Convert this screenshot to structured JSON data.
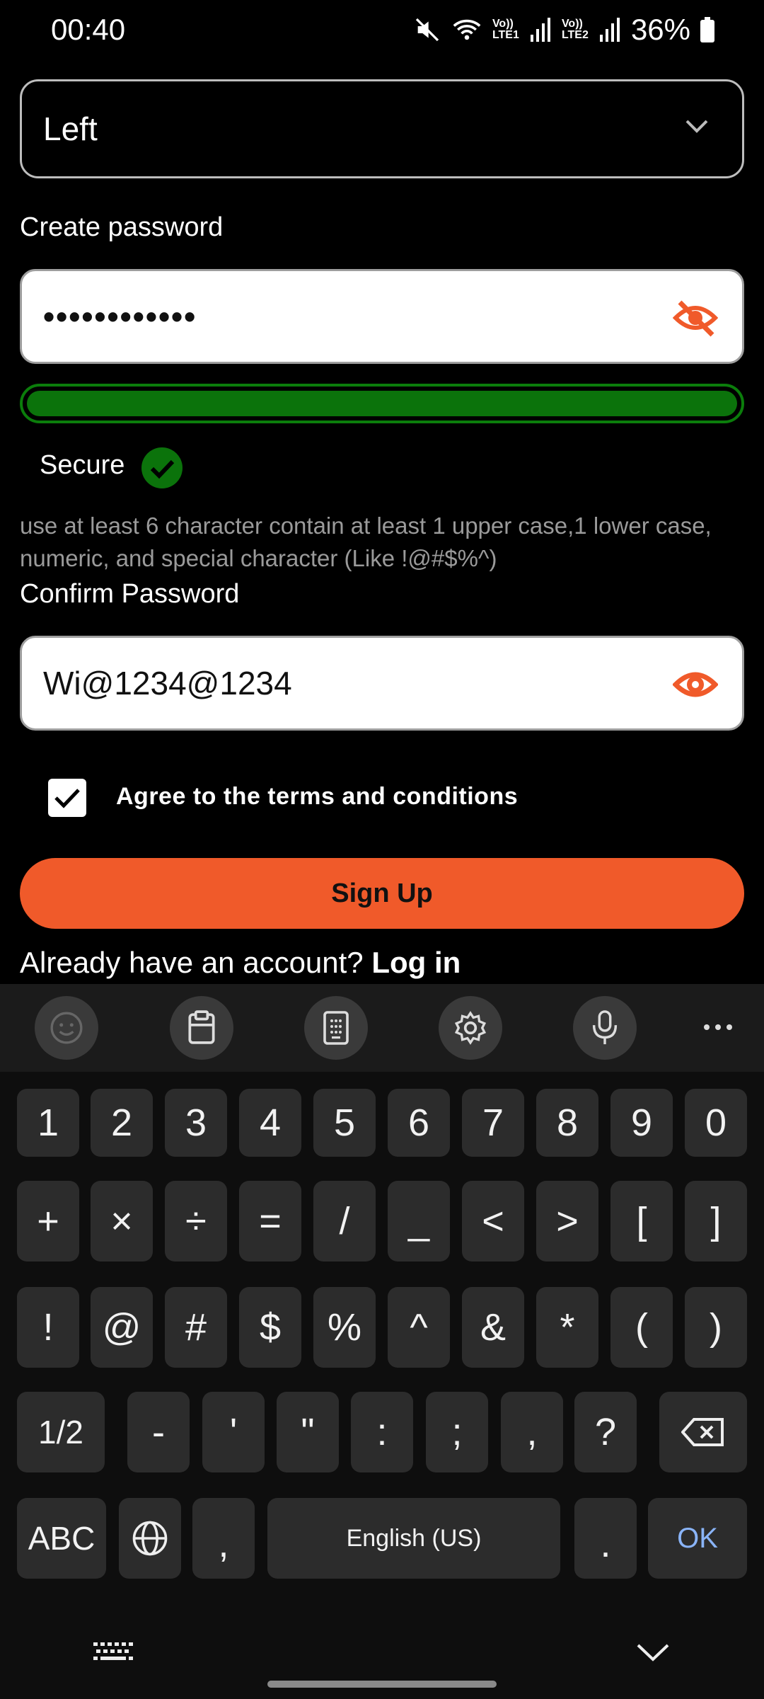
{
  "status": {
    "time": "00:40",
    "battery": "36%",
    "sim1": "Vo)) LTE1",
    "sim2": "Vo)) LTE2"
  },
  "form": {
    "side_select_value": "Left",
    "create_password_label": "Create password",
    "password_masked": "••••••••••••",
    "strength_fraction": 1.0,
    "strength_color": "#0b730b",
    "secure_label": "Secure",
    "hint": "use at least 6 character contain at least 1 upper case,1 lower case, numeric, and special character (Like !@#$%^)",
    "confirm_label": "Confirm Password",
    "confirm_value": "Wi@1234@1234",
    "agree_label": "Agree to the terms and conditions",
    "agree_checked": true,
    "signup_label": "Sign Up",
    "already_text": "Already have an account?",
    "login_link": "Log in",
    "accent": "#f05a2a"
  },
  "keyboard": {
    "toolbar": [
      "emoji-icon",
      "clipboard-icon",
      "keypad-icon",
      "settings-icon",
      "mic-icon",
      "more-icon"
    ],
    "row1": [
      "1",
      "2",
      "3",
      "4",
      "5",
      "6",
      "7",
      "8",
      "9",
      "0"
    ],
    "row2": [
      "+",
      "×",
      "÷",
      "=",
      "/",
      "_",
      "<",
      ">",
      "[",
      "]"
    ],
    "row3": [
      "!",
      "@",
      "#",
      "$",
      "%",
      "^",
      "&",
      "*",
      "(",
      ")"
    ],
    "row4": [
      "1/2",
      "-",
      "'",
      "\"",
      ":",
      ";",
      ",",
      "?"
    ],
    "row5": {
      "abc": "ABC",
      "comma": ",",
      "space": "English (US)",
      "period": ".",
      "ok": "OK"
    }
  }
}
